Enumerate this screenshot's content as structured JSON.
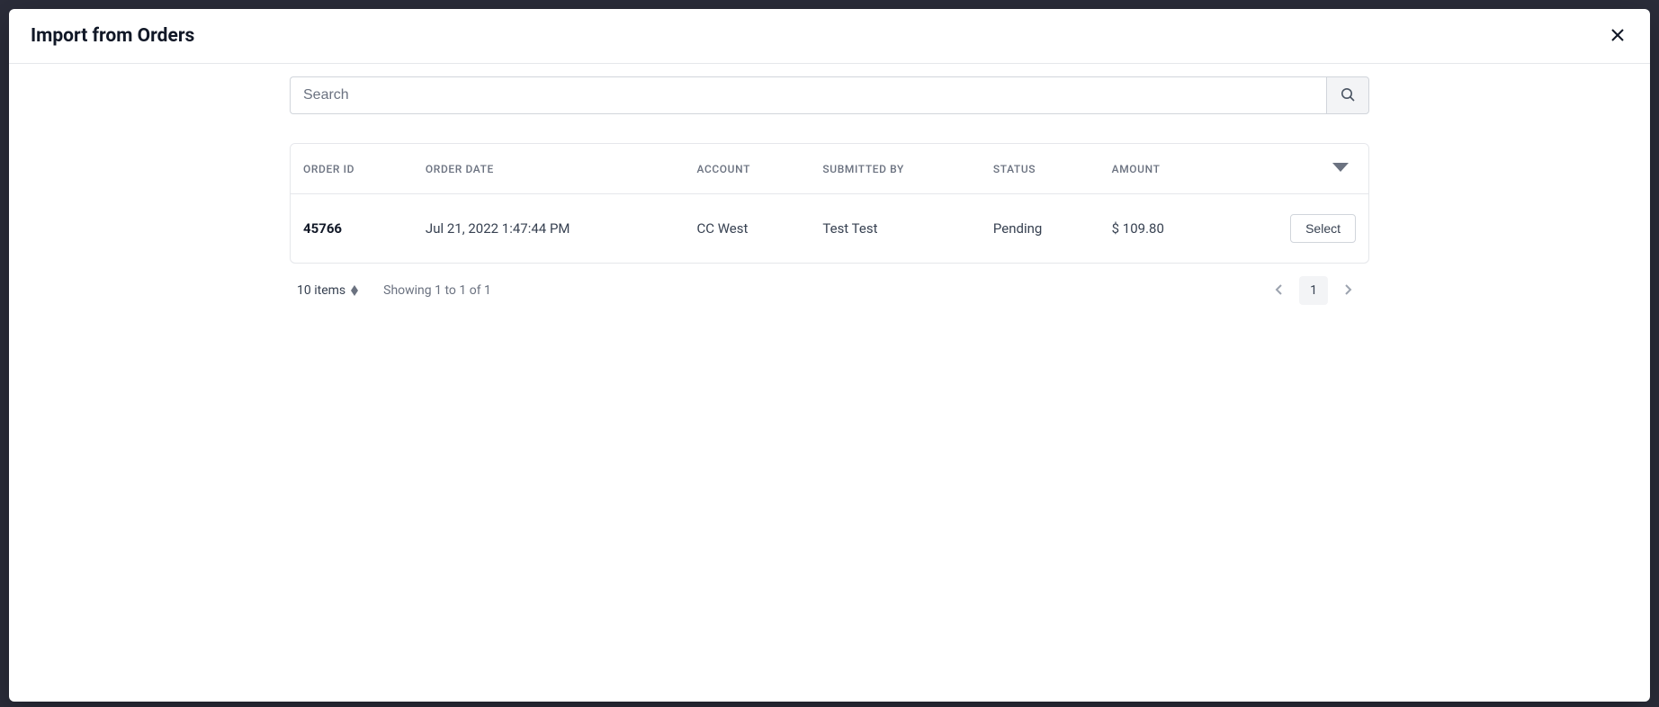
{
  "modal": {
    "title": "Import from Orders"
  },
  "search": {
    "placeholder": "Search",
    "value": ""
  },
  "table": {
    "headers": {
      "order_id": "ORDER ID",
      "order_date": "ORDER DATE",
      "account": "ACCOUNT",
      "submitted_by": "SUBMITTED BY",
      "status": "STATUS",
      "amount": "AMOUNT"
    },
    "rows": [
      {
        "order_id": "45766",
        "order_date": "Jul 21, 2022 1:47:44 PM",
        "account": "CC West",
        "submitted_by": "Test Test",
        "status": "Pending",
        "amount": "$ 109.80",
        "action_label": "Select"
      }
    ]
  },
  "footer": {
    "page_size": "10 items",
    "showing": "Showing 1 to 1 of 1",
    "current_page": "1"
  }
}
